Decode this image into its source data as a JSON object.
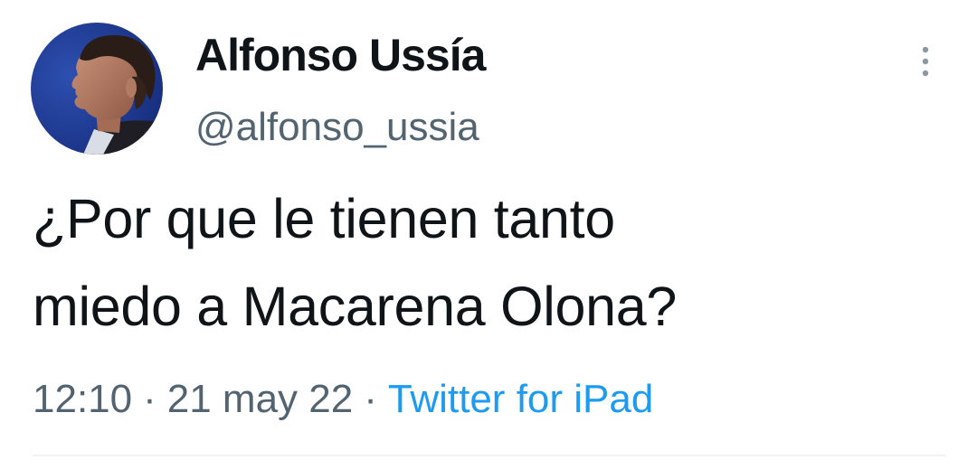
{
  "user": {
    "display_name": "Alfonso Ussía",
    "handle": "@alfonso_ussia",
    "avatar_icon": "profile-photo"
  },
  "tweet": {
    "text_line_1": "¿Por que le tienen tanto",
    "text_line_2": "miedo a Macarena Olona?"
  },
  "meta": {
    "time": "12:10",
    "separator": "·",
    "date": "21 may 22",
    "source": "Twitter for iPad"
  },
  "icons": {
    "more": "more-vertical-icon"
  },
  "colors": {
    "text": "#0f1419",
    "secondary": "#536471",
    "link": "#1d9bf0",
    "divider": "#eff3f4"
  }
}
